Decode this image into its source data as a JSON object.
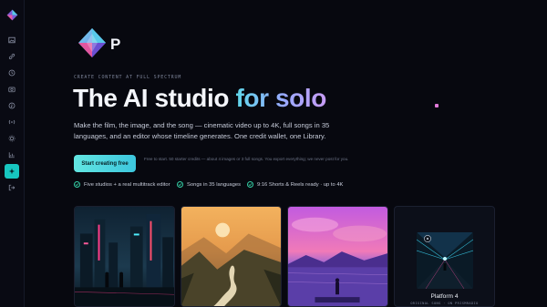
{
  "sidebar": {
    "items": [
      {
        "icon": "image-icon"
      },
      {
        "icon": "link-icon"
      },
      {
        "icon": "clock-icon"
      },
      {
        "icon": "camera-icon"
      },
      {
        "icon": "music-icon"
      },
      {
        "icon": "broadcast-icon"
      },
      {
        "icon": "settings-icon"
      },
      {
        "icon": "chart-icon"
      },
      {
        "icon": "sparkle-icon",
        "active": true
      },
      {
        "icon": "logout-icon"
      }
    ]
  },
  "brand": {
    "letter": "P"
  },
  "hero": {
    "eyebrow": "CREATE CONTENT AT FULL SPECTRUM",
    "headline_plain": "The AI studio ",
    "headline_accent": "for solo",
    "subtitle": "Make the film, the image, and the song — cinematic video up to 4K, full songs in 35 languages, and an editor whose timeline generates. One credit wallet, one Library.",
    "cta_label": "Start creating free",
    "cta_note": "Free to start. 50 starter credits — about 4 images or 3 full songs. You export everything; we never post for you."
  },
  "features": [
    "Five studios + a real multitrack editor",
    "Songs in 35 languages",
    "9:16 Shorts & Reels ready · up to 4K"
  ],
  "gallery": {
    "platform_title": "Platform 4",
    "platform_subtitle": "ORIGINAL SONG · ON PRISMRADIO"
  },
  "colors": {
    "background": "#07080f",
    "accent": "#17c6c0",
    "cta": "#4fd9df",
    "check": "#34cfa5"
  }
}
